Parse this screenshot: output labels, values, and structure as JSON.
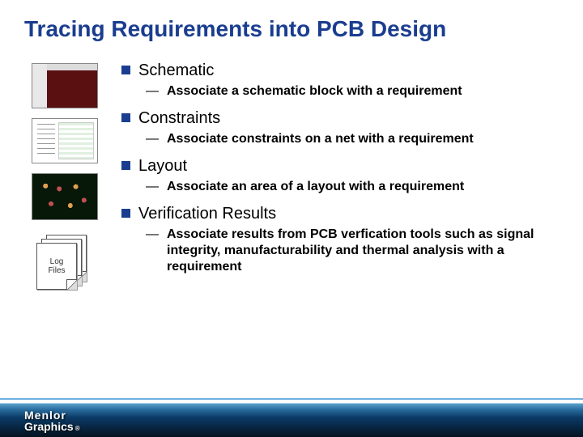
{
  "title": "Tracing Requirements into PCB Design",
  "sections": [
    {
      "heading": "Schematic",
      "sub": "Associate a schematic block with a requirement"
    },
    {
      "heading": "Constraints",
      "sub": "Associate constraints on a net with a requirement"
    },
    {
      "heading": "Layout",
      "sub": "Associate an area of a layout with a requirement"
    },
    {
      "heading": "Verification Results",
      "sub": "Associate results from PCB verfication tools such as signal integrity, manufacturability and thermal analysis with a requirement"
    }
  ],
  "logfile_label": "Log Files",
  "logo": {
    "line1": "Menlor",
    "line2": "Graphics",
    "reg": "®"
  }
}
